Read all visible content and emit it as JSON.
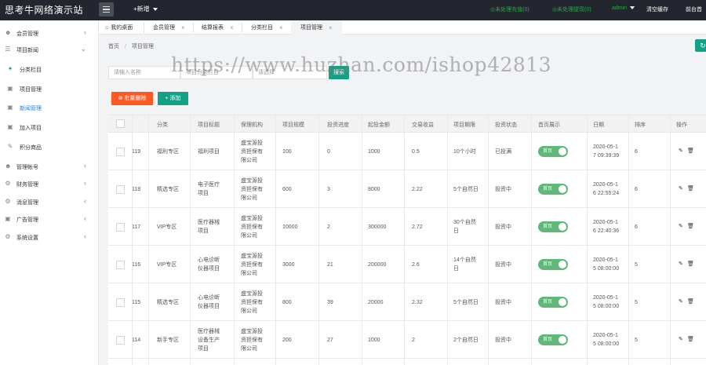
{
  "brand": "思考牛网络演示站",
  "topbar": {
    "new_label": "+新增",
    "link1": "◎未处理充值(0)",
    "link2": "◎未处理提现(0)",
    "admin": "admin",
    "clear_cache": "清空缓存",
    "front": "前台首"
  },
  "sidebar": {
    "items": [
      {
        "label": "会员管理",
        "icon": "user-icon"
      },
      {
        "label": "项目新闻",
        "icon": "list-icon"
      },
      {
        "label": "分类栏目",
        "icon": "bullet-icon"
      },
      {
        "label": "项目管理",
        "icon": "cart-icon"
      },
      {
        "label": "新闻管理",
        "icon": "cart-icon"
      },
      {
        "label": "加入项目",
        "icon": "cart-icon"
      },
      {
        "label": "积分商品",
        "icon": "edit-icon"
      },
      {
        "label": "管理帐号",
        "icon": "group-icon"
      },
      {
        "label": "财务管理",
        "icon": "gear-icon"
      },
      {
        "label": "消息管理",
        "icon": "gear-icon"
      },
      {
        "label": "广告管理",
        "icon": "picture-icon"
      },
      {
        "label": "系统设置",
        "icon": "gear-icon"
      }
    ]
  },
  "tabs": [
    {
      "label": "我的桌面"
    },
    {
      "label": "会员管理"
    },
    {
      "label": "结算报表"
    },
    {
      "label": "分类栏目"
    },
    {
      "label": "项目管理"
    }
  ],
  "breadcrumb": {
    "home": "首页",
    "sep": "/",
    "current": "项目管理"
  },
  "search": {
    "placeholder1": "请输入名称",
    "placeholder2": "项目分类栏目",
    "placeholder3": "请选择",
    "button": "搜索"
  },
  "actions": {
    "batch_delete": "批量删除",
    "add": "添加"
  },
  "table": {
    "headers": [
      "分类",
      "项目标题",
      "保理机构",
      "项目规模",
      "投资进度",
      "起投金额",
      "交易收益",
      "项目期限",
      "投资状态",
      "首页展示",
      "日期",
      "排序",
      "操作"
    ],
    "rows": [
      {
        "id": "119",
        "category": "福利专区",
        "title": [
          "福利项目"
        ],
        "org": [
          "盛宝源投",
          "资担保有",
          "限公司"
        ],
        "scale": "100",
        "progress": "0",
        "min": "1000",
        "yield": "0.5",
        "term": [
          "10个小时"
        ],
        "status": "已投满",
        "home": "首页",
        "date": [
          "2020-05-1",
          "7 09:39:39"
        ],
        "sort": "6"
      },
      {
        "id": "118",
        "category": "精选专区",
        "title": [
          "电子医疗",
          "项目"
        ],
        "org": [
          "盛宝源投",
          "资担保有",
          "限公司"
        ],
        "scale": "600",
        "progress": "3",
        "min": "8000",
        "yield": "2.22",
        "term": [
          "5个自然日"
        ],
        "status": "投资中",
        "home": "首页",
        "date": [
          "2020-05-1",
          "6 22:55:24"
        ],
        "sort": "6"
      },
      {
        "id": "117",
        "category": "VIP专区",
        "title": [
          "医疗器械",
          "项目"
        ],
        "org": [
          "盛宝源投",
          "资担保有",
          "限公司"
        ],
        "scale": "10000",
        "progress": "2",
        "min": "300000",
        "yield": "2.72",
        "term": [
          "30个自然",
          "日"
        ],
        "status": "投资中",
        "home": "首页",
        "date": [
          "2020-05-1",
          "6 22:40:36"
        ],
        "sort": "6"
      },
      {
        "id": "116",
        "category": "VIP专区",
        "title": [
          "心电诊断",
          "仪器项目"
        ],
        "org": [
          "盛宝源投",
          "资担保有",
          "限公司"
        ],
        "scale": "3000",
        "progress": "21",
        "min": "200000",
        "yield": "2.6",
        "term": [
          "14个自然",
          "日"
        ],
        "status": "投资中",
        "home": "首页",
        "date": [
          "2020-05-1",
          "5 08:00:00"
        ],
        "sort": "5"
      },
      {
        "id": "115",
        "category": "精选专区",
        "title": [
          "心电诊断",
          "仪器项目"
        ],
        "org": [
          "盛宝源投",
          "资担保有",
          "限公司"
        ],
        "scale": "800",
        "progress": "39",
        "min": "20000",
        "yield": "2.32",
        "term": [
          "5个自然日"
        ],
        "status": "投资中",
        "home": "首页",
        "date": [
          "2020-05-1",
          "5 08:00:00"
        ],
        "sort": "5"
      },
      {
        "id": "114",
        "category": "新手专区",
        "title": [
          "医疗器械",
          "设备生产",
          "项目"
        ],
        "org": [
          "盛宝源投",
          "资担保有",
          "限公司"
        ],
        "scale": "200",
        "progress": "27",
        "min": "1000",
        "yield": "2",
        "term": [
          "2个自然日"
        ],
        "status": "投资中",
        "home": "首页",
        "date": [
          "2020-05-1",
          "5 08:00:00"
        ],
        "sort": "5"
      }
    ]
  },
  "watermark": "https://www.huzhan.com/ishop42813"
}
